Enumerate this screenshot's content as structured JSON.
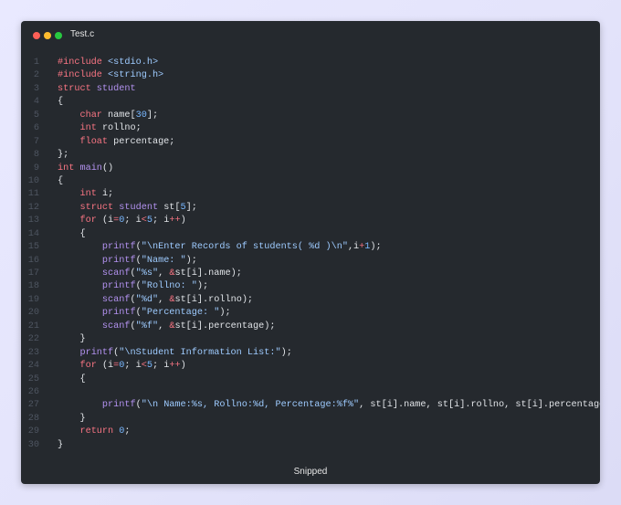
{
  "window": {
    "title": "Test.c",
    "footer": "Snipped"
  },
  "colors": {
    "background": "#25292e",
    "keyword": "#f97583",
    "type": "#b392f0",
    "string": "#9ecbff",
    "number": "#79b8ff",
    "plain": "#e1e4e8",
    "line_number": "#4e5561"
  },
  "code": {
    "language": "c",
    "lines": [
      [
        [
          "kw",
          "#include "
        ],
        [
          "st",
          "<stdio.h>"
        ]
      ],
      [
        [
          "kw",
          "#include "
        ],
        [
          "st",
          "<string.h>"
        ]
      ],
      [
        [
          "kw",
          "struct "
        ],
        [
          "ty",
          "student"
        ]
      ],
      [
        [
          "pl",
          "{"
        ]
      ],
      [
        [
          "pl",
          "    "
        ],
        [
          "kw",
          "char "
        ],
        [
          "pl",
          "name["
        ],
        [
          "nu",
          "30"
        ],
        [
          "pl",
          "];"
        ]
      ],
      [
        [
          "pl",
          "    "
        ],
        [
          "kw",
          "int "
        ],
        [
          "pl",
          "rollno;"
        ]
      ],
      [
        [
          "pl",
          "    "
        ],
        [
          "kw",
          "float "
        ],
        [
          "pl",
          "percentage;"
        ]
      ],
      [
        [
          "pl",
          "};"
        ]
      ],
      [
        [
          "kw",
          "int "
        ],
        [
          "ty",
          "main"
        ],
        [
          "pl",
          "()"
        ]
      ],
      [
        [
          "pl",
          "{"
        ]
      ],
      [
        [
          "pl",
          "    "
        ],
        [
          "kw",
          "int "
        ],
        [
          "pl",
          "i;"
        ]
      ],
      [
        [
          "pl",
          "    "
        ],
        [
          "kw",
          "struct "
        ],
        [
          "ty",
          "student "
        ],
        [
          "pl",
          "st["
        ],
        [
          "nu",
          "5"
        ],
        [
          "pl",
          "];"
        ]
      ],
      [
        [
          "pl",
          "    "
        ],
        [
          "kw",
          "for "
        ],
        [
          "pl",
          "(i"
        ],
        [
          "kw",
          "="
        ],
        [
          "nu",
          "0"
        ],
        [
          "pl",
          "; i"
        ],
        [
          "kw",
          "<"
        ],
        [
          "nu",
          "5"
        ],
        [
          "pl",
          "; i"
        ],
        [
          "kw",
          "++"
        ],
        [
          "pl",
          ")"
        ]
      ],
      [
        [
          "pl",
          "    {"
        ]
      ],
      [
        [
          "pl",
          "        "
        ],
        [
          "ty",
          "printf"
        ],
        [
          "pl",
          "("
        ],
        [
          "st",
          "\"\\nEnter Records of students( %d )\\n\""
        ],
        [
          "pl",
          ",i"
        ],
        [
          "kw",
          "+"
        ],
        [
          "nu",
          "1"
        ],
        [
          "pl",
          ");"
        ]
      ],
      [
        [
          "pl",
          "        "
        ],
        [
          "ty",
          "printf"
        ],
        [
          "pl",
          "("
        ],
        [
          "st",
          "\"Name: \""
        ],
        [
          "pl",
          ");"
        ]
      ],
      [
        [
          "pl",
          "        "
        ],
        [
          "ty",
          "scanf"
        ],
        [
          "pl",
          "("
        ],
        [
          "st",
          "\"%s\""
        ],
        [
          "pl",
          ", "
        ],
        [
          "kw",
          "&"
        ],
        [
          "pl",
          "st[i].name);"
        ]
      ],
      [
        [
          "pl",
          "        "
        ],
        [
          "ty",
          "printf"
        ],
        [
          "pl",
          "("
        ],
        [
          "st",
          "\"Rollno: \""
        ],
        [
          "pl",
          ");"
        ]
      ],
      [
        [
          "pl",
          "        "
        ],
        [
          "ty",
          "scanf"
        ],
        [
          "pl",
          "("
        ],
        [
          "st",
          "\"%d\""
        ],
        [
          "pl",
          ", "
        ],
        [
          "kw",
          "&"
        ],
        [
          "pl",
          "st[i].rollno);"
        ]
      ],
      [
        [
          "pl",
          "        "
        ],
        [
          "ty",
          "printf"
        ],
        [
          "pl",
          "("
        ],
        [
          "st",
          "\"Percentage: \""
        ],
        [
          "pl",
          ");"
        ]
      ],
      [
        [
          "pl",
          "        "
        ],
        [
          "ty",
          "scanf"
        ],
        [
          "pl",
          "("
        ],
        [
          "st",
          "\"%f\""
        ],
        [
          "pl",
          ", "
        ],
        [
          "kw",
          "&"
        ],
        [
          "pl",
          "st[i].percentage);"
        ]
      ],
      [
        [
          "pl",
          "    }"
        ]
      ],
      [
        [
          "pl",
          "    "
        ],
        [
          "ty",
          "printf"
        ],
        [
          "pl",
          "("
        ],
        [
          "st",
          "\"\\nStudent Information List:\""
        ],
        [
          "pl",
          ");"
        ]
      ],
      [
        [
          "pl",
          "    "
        ],
        [
          "kw",
          "for "
        ],
        [
          "pl",
          "(i"
        ],
        [
          "kw",
          "="
        ],
        [
          "nu",
          "0"
        ],
        [
          "pl",
          "; i"
        ],
        [
          "kw",
          "<"
        ],
        [
          "nu",
          "5"
        ],
        [
          "pl",
          "; i"
        ],
        [
          "kw",
          "++"
        ],
        [
          "pl",
          ")"
        ]
      ],
      [
        [
          "pl",
          "    {"
        ]
      ],
      [
        [
          "pl",
          ""
        ]
      ],
      [
        [
          "pl",
          "        "
        ],
        [
          "ty",
          "printf"
        ],
        [
          "pl",
          "("
        ],
        [
          "st",
          "\"\\n Name:%s, Rollno:%d, Percentage:%f%\""
        ],
        [
          "pl",
          ", st[i].name, st[i].rollno, st[i].percentage);"
        ]
      ],
      [
        [
          "pl",
          "    }"
        ]
      ],
      [
        [
          "pl",
          "    "
        ],
        [
          "kw",
          "return "
        ],
        [
          "nu",
          "0"
        ],
        [
          "pl",
          ";"
        ]
      ],
      [
        [
          "pl",
          "}"
        ]
      ]
    ]
  }
}
